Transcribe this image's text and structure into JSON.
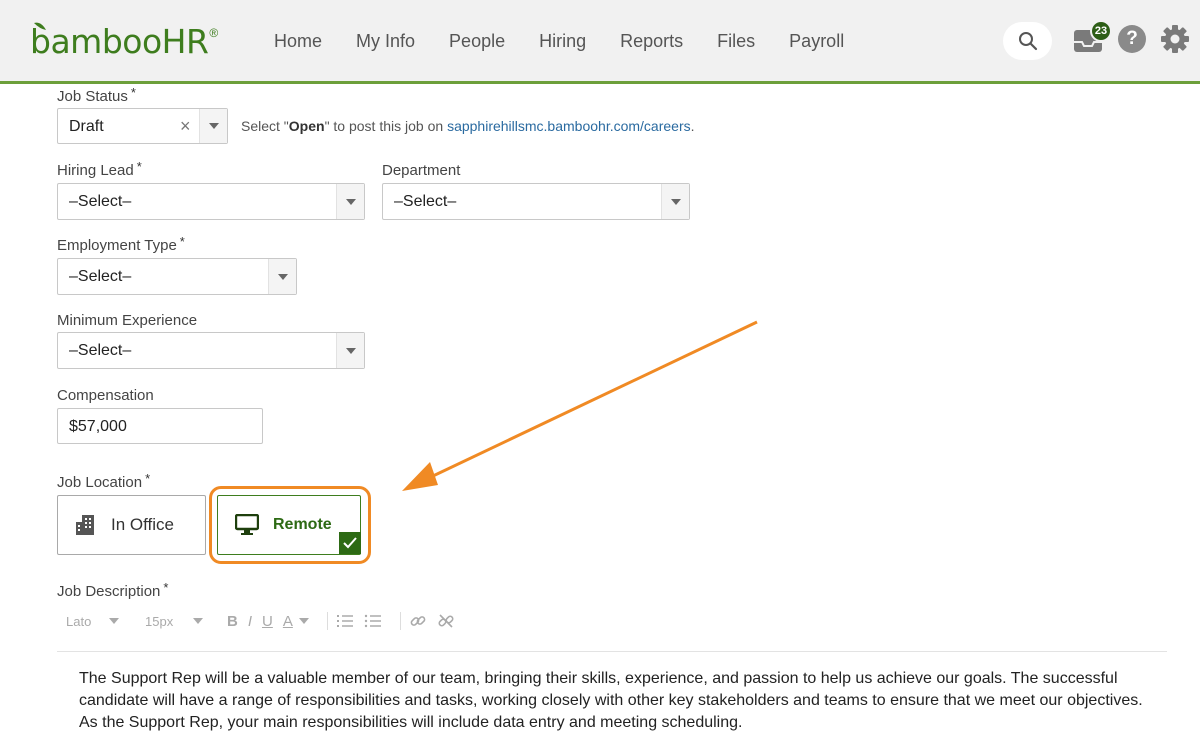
{
  "header": {
    "logo_text": "bamboo",
    "logo_hr": "HR",
    "logo_reg": "®",
    "nav": [
      "Home",
      "My Info",
      "People",
      "Hiring",
      "Reports",
      "Files",
      "Payroll"
    ],
    "inbox_count": "23",
    "help_glyph": "?"
  },
  "form": {
    "job_status": {
      "label": "Job Status",
      "value": "Draft",
      "clear": "×"
    },
    "hint": {
      "prefix": "Select \"",
      "bold": "Open",
      "mid": "\" to post this job on ",
      "link": "sapphirehillsmc.bamboohr.com/careers",
      "suffix": "."
    },
    "hiring_lead": {
      "label": "Hiring Lead",
      "value": "–Select–"
    },
    "department": {
      "label": "Department",
      "value": "–Select–"
    },
    "employment_type": {
      "label": "Employment Type",
      "value": "–Select–"
    },
    "min_experience": {
      "label": "Minimum Experience",
      "value": "–Select–"
    },
    "compensation": {
      "label": "Compensation",
      "value": "$57,000"
    },
    "job_location": {
      "label": "Job Location",
      "options": [
        "In Office",
        "Remote"
      ],
      "selected": "Remote"
    },
    "job_description": {
      "label": "Job Description",
      "toolbar": {
        "font": "Lato",
        "size": "15px",
        "bold": "B",
        "italic": "I",
        "underline": "U",
        "color": "A"
      },
      "text": "The Support Rep will be a valuable member of our team, bringing their skills, experience, and passion to help us achieve our goals. The successful candidate will have a range of responsibilities and tasks, working closely with other key stakeholders and teams to ensure that we meet our objectives. As the Support Rep, your main responsibilities will include data entry and meeting scheduling."
    },
    "required_mark": "*"
  },
  "colors": {
    "brand_green": "#3e7d1e",
    "highlight_orange": "#f08a24",
    "header_bg": "#f1f1f1"
  }
}
